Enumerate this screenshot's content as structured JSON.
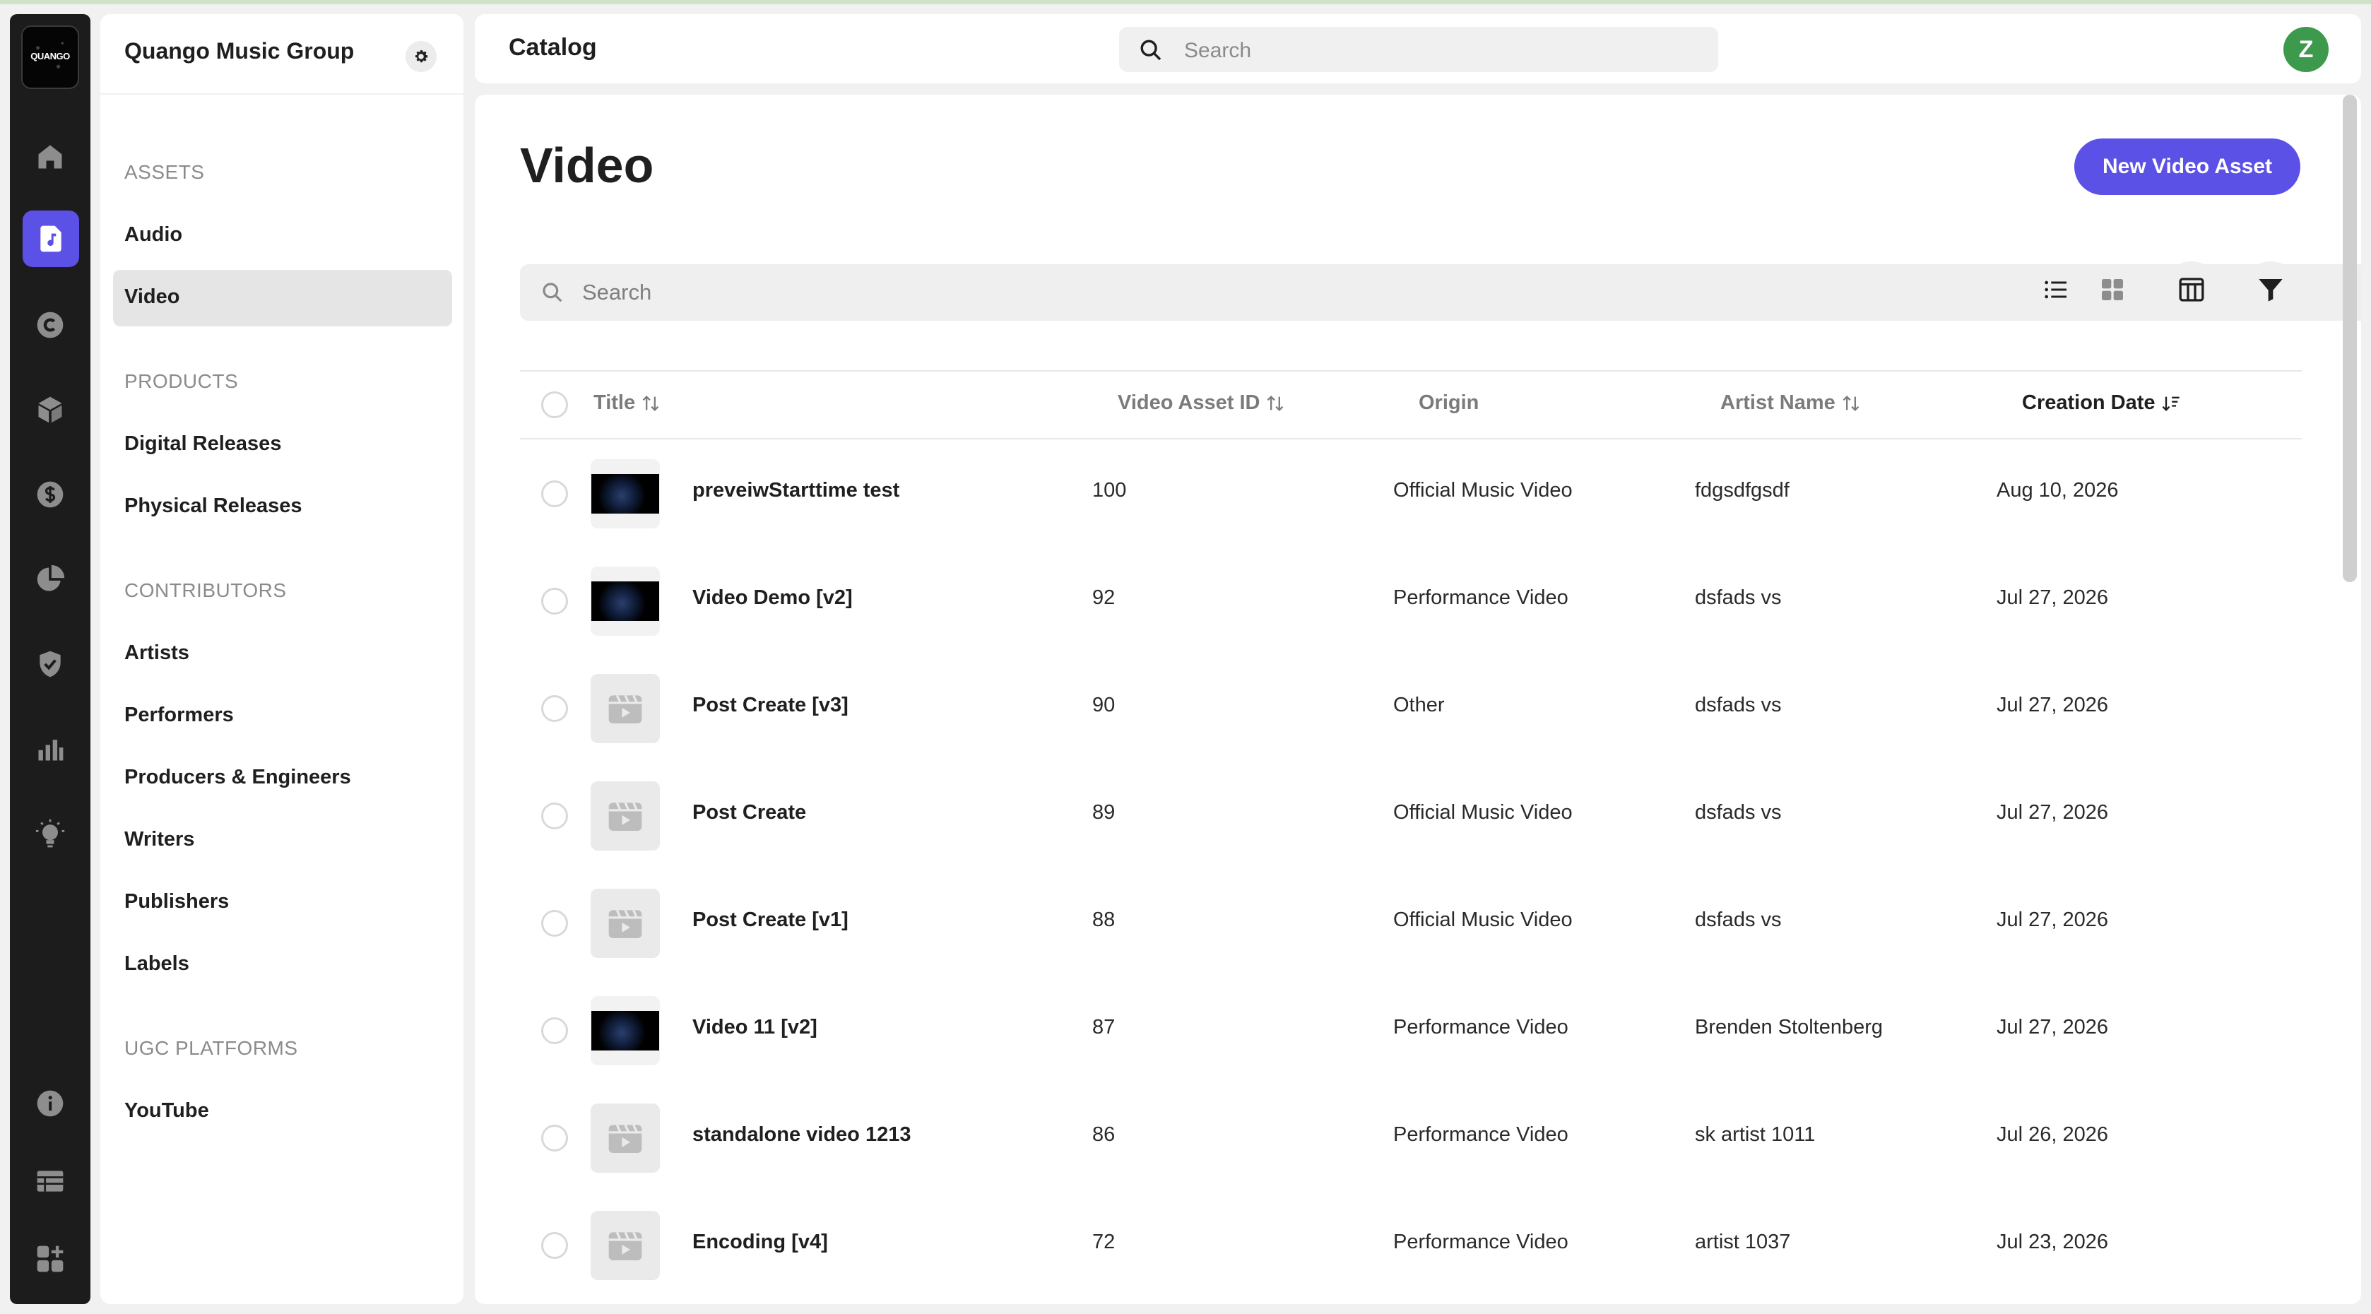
{
  "rail": {
    "logo_text": "QUANGO",
    "icons": [
      "home-icon",
      "music-file-icon",
      "copyright-icon",
      "cube-icon",
      "dollar-icon",
      "pie-chart-icon",
      "shield-check-icon",
      "bar-chart-icon",
      "lightbulb-icon",
      "info-icon",
      "table-icon",
      "apps-add-icon"
    ]
  },
  "sidebar": {
    "org_name": "Quango Music Group",
    "sections": {
      "assets": "ASSETS",
      "products": "PRODUCTS",
      "contributors": "CONTRIBUTORS",
      "ugc": "UGC PLATFORMS"
    },
    "items": {
      "audio": "Audio",
      "video": "Video",
      "digital_releases": "Digital Releases",
      "physical_releases": "Physical Releases",
      "artists": "Artists",
      "performers": "Performers",
      "producers": "Producers & Engineers",
      "writers": "Writers",
      "publishers": "Publishers",
      "labels": "Labels",
      "youtube": "YouTube"
    }
  },
  "header": {
    "breadcrumb": "Catalog",
    "search_placeholder": "Search",
    "avatar_letter": "Z"
  },
  "main": {
    "title": "Video",
    "new_button": "New Video Asset",
    "search_placeholder": "Search",
    "columns": {
      "title": "Title",
      "asset_id": "Video Asset ID",
      "origin": "Origin",
      "artist": "Artist Name",
      "created": "Creation Date"
    },
    "rows": [
      {
        "title": "preveiwStarttime test",
        "id": "100",
        "origin": "Official Music Video",
        "artist": "fdgsdfgsdf",
        "date": "Aug 10, 2026",
        "thumb": "video"
      },
      {
        "title": "Video Demo [v2]",
        "id": "92",
        "origin": "Performance Video",
        "artist": "dsfads vs",
        "date": "Jul 27, 2026",
        "thumb": "video"
      },
      {
        "title": "Post Create [v3]",
        "id": "90",
        "origin": "Other",
        "artist": "dsfads vs",
        "date": "Jul 27, 2026",
        "thumb": "placeholder"
      },
      {
        "title": "Post Create",
        "id": "89",
        "origin": "Official Music Video",
        "artist": "dsfads vs",
        "date": "Jul 27, 2026",
        "thumb": "placeholder"
      },
      {
        "title": "Post Create [v1]",
        "id": "88",
        "origin": "Official Music Video",
        "artist": "dsfads vs",
        "date": "Jul 27, 2026",
        "thumb": "placeholder"
      },
      {
        "title": "Video 11 [v2]",
        "id": "87",
        "origin": "Performance Video",
        "artist": "Brenden Stoltenberg",
        "date": "Jul 27, 2026",
        "thumb": "video"
      },
      {
        "title": "standalone video 1213",
        "id": "86",
        "origin": "Performance Video",
        "artist": "sk artist 1011",
        "date": "Jul 26, 2026",
        "thumb": "placeholder"
      },
      {
        "title": "Encoding [v4]",
        "id": "72",
        "origin": "Performance Video",
        "artist": "artist 1037",
        "date": "Jul 23, 2026",
        "thumb": "placeholder"
      }
    ]
  },
  "colors": {
    "accent": "#5b51e6",
    "rail_bg": "#1c1c1c",
    "avatar": "#3d9a4d",
    "active_nav": "#e5e5e5"
  }
}
